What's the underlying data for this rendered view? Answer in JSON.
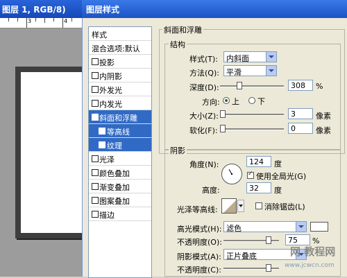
{
  "background_window": {
    "title": "图层 1, RGB/8)",
    "ruler_numbers": [
      "3",
      "4"
    ]
  },
  "dialog": {
    "title": "图层样式",
    "styles_list": {
      "header": "样式",
      "blend": "混合选项:默认",
      "items": [
        {
          "label": "投影",
          "checked": false
        },
        {
          "label": "内阴影",
          "checked": false
        },
        {
          "label": "外发光",
          "checked": false
        },
        {
          "label": "内发光",
          "checked": false
        },
        {
          "label": "斜面和浮雕",
          "checked": true,
          "selected": true
        },
        {
          "label": "等高线",
          "checked": false,
          "sub": true
        },
        {
          "label": "纹理",
          "checked": false,
          "sub": true
        },
        {
          "label": "光泽",
          "checked": false
        },
        {
          "label": "颜色叠加",
          "checked": false
        },
        {
          "label": "渐变叠加",
          "checked": false
        },
        {
          "label": "图案叠加",
          "checked": false
        },
        {
          "label": "描边",
          "checked": false
        }
      ]
    },
    "bevel_emboss": {
      "section_title": "斜面和浮雕",
      "structure": {
        "title": "结构",
        "style_label": "样式(T):",
        "style_value": "内斜面",
        "technique_label": "方法(Q):",
        "technique_value": "平滑",
        "depth_label": "深度(D):",
        "depth_value": "308",
        "depth_unit": "%",
        "direction_label": "方向:",
        "dir_up": "上",
        "dir_down": "下",
        "size_label": "大小(Z):",
        "size_value": "3",
        "size_unit": "像素",
        "soften_label": "软化(F):",
        "soften_value": "0",
        "soften_unit": "像素"
      },
      "shading": {
        "title": "阴影",
        "angle_label": "角度(N):",
        "angle_value": "124",
        "angle_unit": "度",
        "global_light": "使用全局光(G)",
        "altitude_label": "高度:",
        "altitude_value": "32",
        "altitude_unit": "度",
        "gloss_label": "光泽等高线:",
        "anti_alias": "消除锯齿(L)",
        "highlight_mode_label": "高光模式(H):",
        "highlight_mode_value": "滤色",
        "highlight_opacity_label": "不透明度(O):",
        "highlight_opacity_value": "75",
        "highlight_opacity_unit": "%",
        "shadow_mode_label": "阴影模式(A):",
        "shadow_mode_value": "正片叠底",
        "shadow_opacity_label": "不透明度(C):",
        "highlight_color": "#ffffff"
      }
    },
    "watermark": {
      "big": "网 教程网",
      "small": "www.jcwcn.com"
    }
  }
}
